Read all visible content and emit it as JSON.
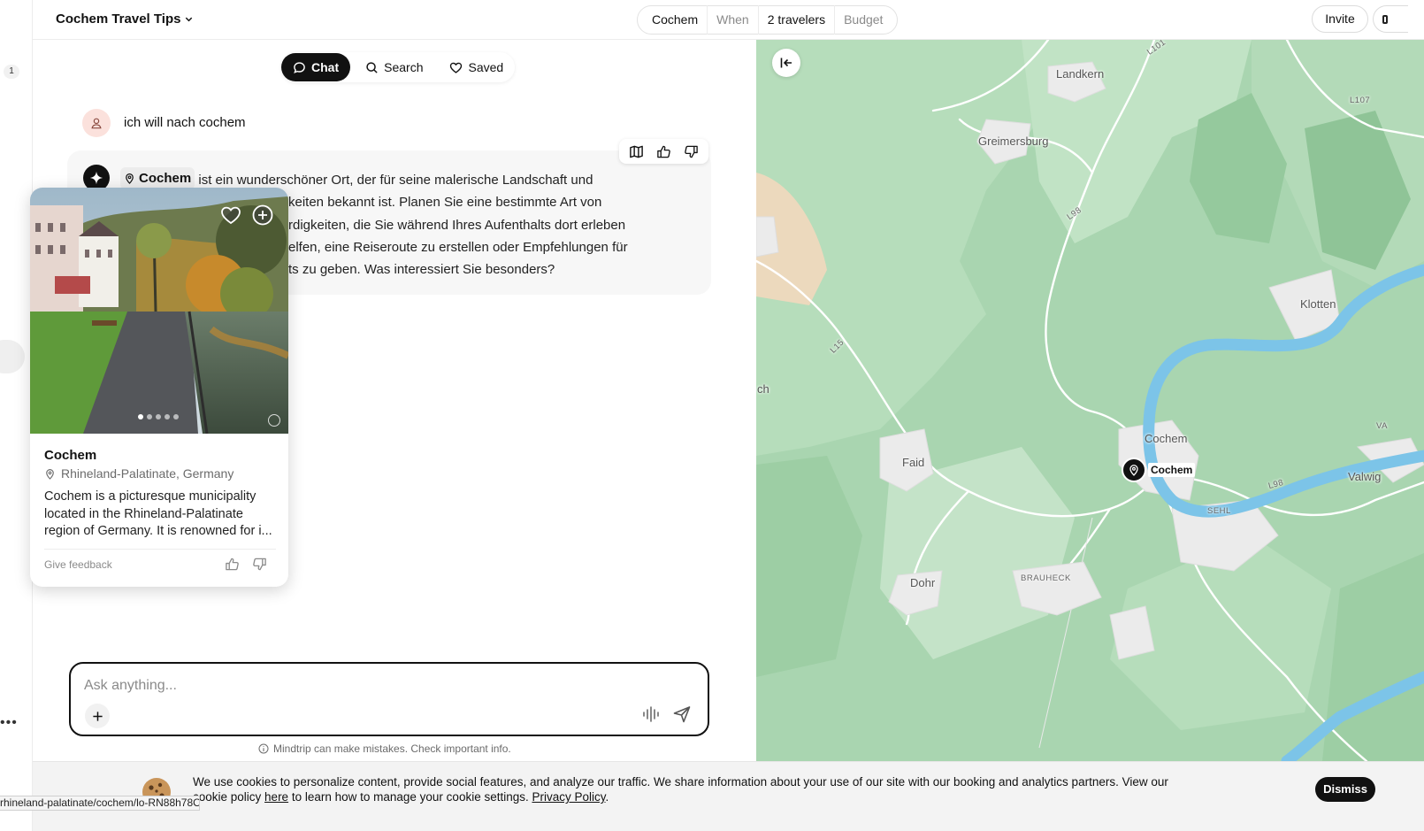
{
  "rail": {
    "badge": "1",
    "more": "•••"
  },
  "header": {
    "trip_title": "Cochem Travel Tips",
    "destination": "Cochem",
    "when": "When",
    "travelers": "2 travelers",
    "budget": "Budget",
    "invite": "Invite"
  },
  "tabs": [
    {
      "label": "Chat",
      "icon": "chat-bubble-icon",
      "active": true
    },
    {
      "label": "Search",
      "icon": "search-icon",
      "active": false
    },
    {
      "label": "Saved",
      "icon": "heart-icon",
      "active": false
    }
  ],
  "conversation": {
    "user_message": "ich will nach cochem",
    "ai_place": "Cochem",
    "ai_line1": " ist ein wunderschöner Ort, der für seine malerische Landschaft und",
    "ai_line2": "keiten bekannt ist. Planen Sie eine bestimmte Art von",
    "ai_line3": "rdigkeiten, die Sie während Ihres Aufenthalts dort erleben",
    "ai_line4": "elfen, eine Reiseroute zu erstellen oder Empfehlungen für",
    "ai_line5": "ts zu geben. Was interessiert Sie besonders?"
  },
  "card": {
    "name": "Cochem",
    "location": "Rhineland-Palatinate, Germany",
    "description": "Cochem is a picturesque municipality located in the Rhineland-Palatinate region of Germany. It is renowned for i...",
    "feedback": "Give feedback",
    "photo_dots": 5,
    "active_dot": 0
  },
  "composer": {
    "placeholder": "Ask anything...",
    "disclaimer": "Mindtrip can make mistakes. Check important info."
  },
  "map": {
    "labels": {
      "landkern": "Landkern",
      "greimersburg": "Greimersburg",
      "klotten": "Klotten",
      "ch": "ch",
      "cochem": "Cochem",
      "valwig": "Valwig",
      "faid": "Faid",
      "sehl": "SEHL",
      "brauheck": "BRAUHECK",
      "dohr": "Dohr",
      "l101": "L101",
      "l107": "L107",
      "l98a": "L98",
      "l98b": "L98",
      "l15": "L15",
      "va": "VA"
    },
    "marker_label": "Cochem",
    "colors": {
      "forest": "#a9d5b0",
      "light_forest": "#c4e3c8",
      "river": "#7cc4e8",
      "settlement": "#ececec",
      "road": "#ffffff"
    }
  },
  "cookie": {
    "text_before": "We use cookies to personalize content, provide social features, and analyze our traffic. We share information about your use of our site with our booking and analytics partners. View our cookie policy ",
    "here": "here",
    "text_middle": " to learn how to manage your cookie settings. ",
    "privacy": "Privacy Policy",
    "text_after": ".",
    "dismiss": "Dismiss"
  },
  "status_url": "rhineland-palatinate/cochem/lo-RN88h78O"
}
